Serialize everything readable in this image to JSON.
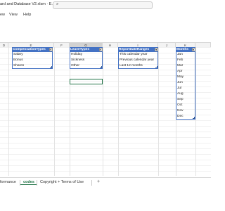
{
  "window": {
    "title": "ard and Database V2.xlsm  ·  E..."
  },
  "menubar": {
    "items": [
      "ew",
      "View",
      "Help"
    ]
  },
  "columns": [
    "D",
    "E",
    "F",
    "G",
    "H",
    "I",
    "J",
    "K"
  ],
  "selected_column": "G",
  "tables": {
    "compensation": {
      "header": "CompensationTypes",
      "rows": [
        "Salary",
        "Bonus",
        "Shares"
      ]
    },
    "leave": {
      "header": "LeaveTypes",
      "rows": [
        "Holiday",
        "Sickness",
        "Other"
      ]
    },
    "report": {
      "header": "ReportDateRanges",
      "rows": [
        "This calendar year",
        "Previous calendar year",
        "Last 12 months"
      ]
    },
    "months": {
      "header": "Months",
      "rows": [
        "Jan",
        "Feb",
        "Mar",
        "Apr",
        "May",
        "Jun",
        "Jul",
        "Aug",
        "Sep",
        "Oct",
        "Nov",
        "Dec"
      ]
    }
  },
  "sheet_tabs": {
    "items": [
      "formance",
      "codes",
      "Copyright + Terms of Use"
    ],
    "active": "codes",
    "add_label": "+"
  },
  "colors": {
    "table_header": "#4472c4",
    "accent": "#217346"
  },
  "icons": {
    "search": "search-icon",
    "dropdown": "dropdown-arrow-icon"
  }
}
